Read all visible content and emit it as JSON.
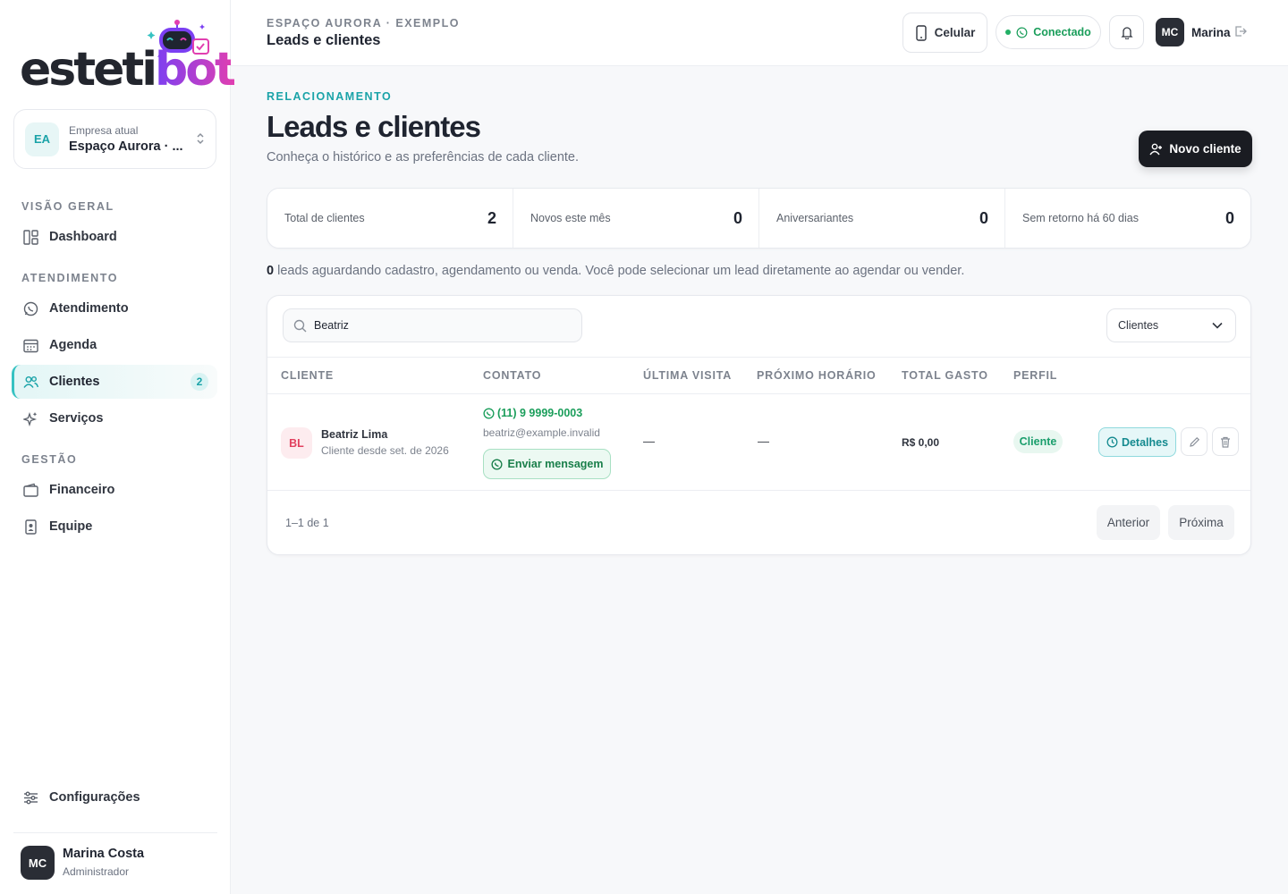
{
  "brand": {
    "logo_text_a": "esteti",
    "logo_text_b": "bot",
    "accent": "#36c2c2"
  },
  "company": {
    "initials": "EA",
    "label": "Empresa atual",
    "name": "Espaço Aurora · ..."
  },
  "sidebar": {
    "sections": [
      {
        "label": "VISÃO GERAL"
      },
      {
        "label": "ATENDIMENTO"
      },
      {
        "label": "GESTÃO"
      }
    ],
    "items": [
      {
        "label": "Dashboard",
        "icon": "dashboard-icon"
      },
      {
        "label": "Atendimento",
        "icon": "whatsapp-icon"
      },
      {
        "label": "Agenda",
        "icon": "calendar-icon"
      },
      {
        "label": "Clientes",
        "icon": "users-icon",
        "badge": "2",
        "active": true
      },
      {
        "label": "Serviços",
        "icon": "sparkles-icon"
      },
      {
        "label": "Financeiro",
        "icon": "wallet-icon"
      },
      {
        "label": "Equipe",
        "icon": "badge-icon"
      },
      {
        "label": "Configurações",
        "icon": "sliders-icon"
      }
    ],
    "user": {
      "initials": "MC",
      "name": "Marina Costa",
      "role": "Administrador"
    }
  },
  "header": {
    "breadcrumb": "ESPAÇO AURORA · EXEMPLO",
    "title": "Leads e clientes",
    "phone_label": "Celular",
    "status_label": "Conectado",
    "user_initials": "MC",
    "user_name": "Marina"
  },
  "main": {
    "eyebrow": "RELACIONAMENTO",
    "title": "Leads e clientes",
    "subtitle": "Conheça o histórico e as preferências de cada cliente.",
    "new_button": "Novo cliente",
    "stats": [
      {
        "label": "Total de clientes",
        "value": "2"
      },
      {
        "label": "Novos este mês",
        "value": "0"
      },
      {
        "label": "Aniversariantes",
        "value": "0"
      },
      {
        "label": "Sem retorno há 60 dias",
        "value": "0"
      }
    ],
    "note_count": "0",
    "note_text": " leads aguardando cadastro, agendamento ou venda. Você pode selecionar um lead diretamente ao agendar ou vender."
  },
  "table": {
    "search_value": "Beatriz",
    "filter_value": "Clientes",
    "columns": [
      "CLIENTE",
      "CONTATO",
      "ÚLTIMA VISITA",
      "PRÓXIMO HORÁRIO",
      "TOTAL GASTO",
      "PERFIL"
    ],
    "rows": [
      {
        "initials": "BL",
        "name": "Beatriz Lima",
        "since": "Cliente desde set. de 2026",
        "phone": "(11) 9 9999-0003",
        "email": "beatriz@example.invalid",
        "send_label": "Enviar mensagem",
        "last_visit": "—",
        "next_slot": "—",
        "total": "R$ 0,00",
        "profile": "Cliente",
        "details_label": "Detalhes"
      }
    ],
    "pagination": {
      "range": "1–1 de 1",
      "prev": "Anterior",
      "next": "Próxima"
    }
  }
}
